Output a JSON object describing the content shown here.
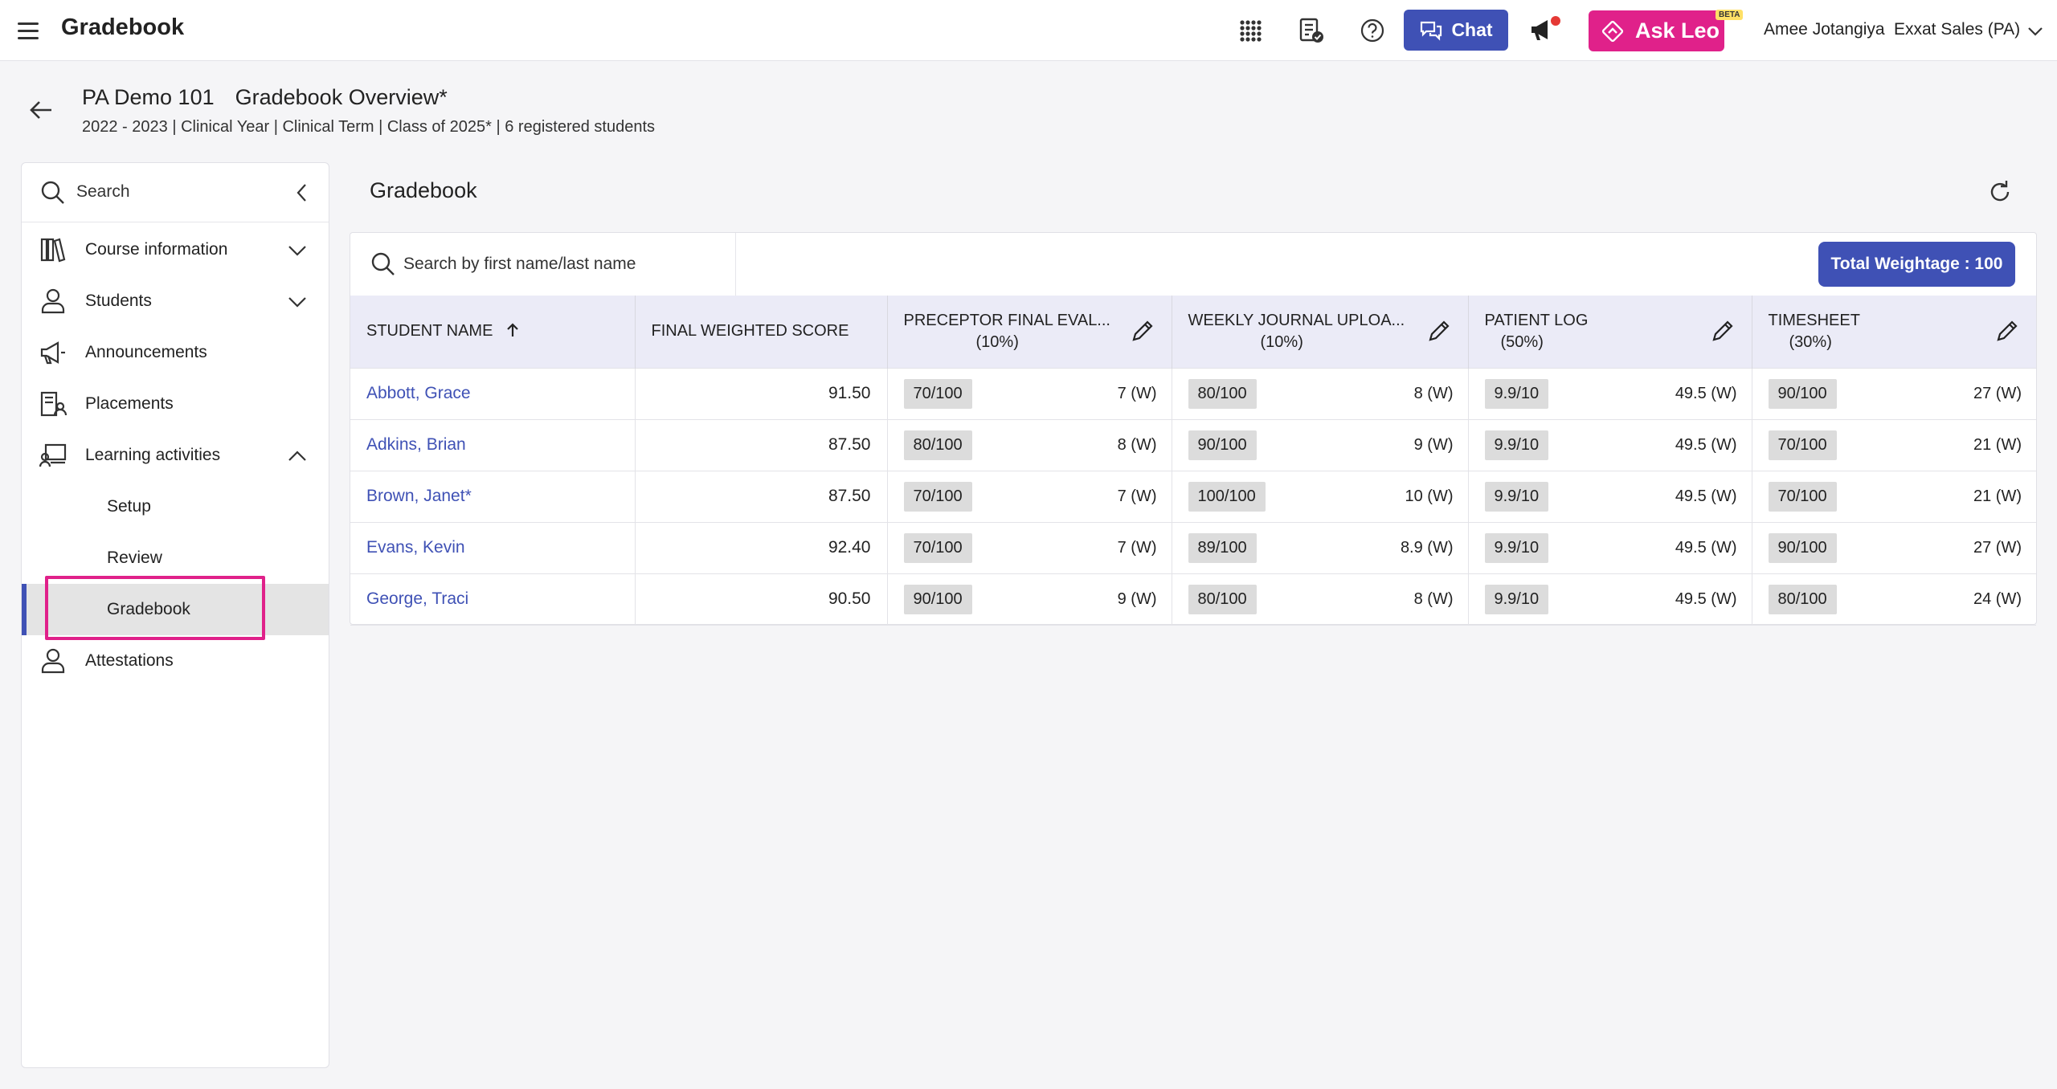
{
  "app": {
    "title": "Gradebook"
  },
  "topbar": {
    "chat_label": "Chat",
    "ask_leo_label": "Ask Leo",
    "beta_label": "BETA",
    "user_name": "Amee Jotangiya",
    "org_name": "Exxat Sales (PA)",
    "icons": [
      "menu-icon",
      "apps-grid-icon",
      "checklist-icon",
      "help-icon",
      "chat-bubble-icon",
      "megaphone-icon",
      "leo-logo-icon",
      "chevron-down-icon"
    ]
  },
  "page": {
    "course_code": "PA Demo 101",
    "course_page": "Gradebook Overview*",
    "subtitle": "2022 - 2023 | Clinical Year | Clinical Term | Class of 2025* | 6 registered students"
  },
  "sidebar": {
    "search_label": "Search",
    "items": [
      {
        "label": "Course information",
        "icon": "books-icon",
        "expanded": false
      },
      {
        "label": "Students",
        "icon": "person-icon",
        "expanded": false
      },
      {
        "label": "Announcements",
        "icon": "megaphone-icon"
      },
      {
        "label": "Placements",
        "icon": "placement-icon"
      },
      {
        "label": "Learning activities",
        "icon": "learning-icon",
        "expanded": true
      },
      {
        "label": "Attestations",
        "icon": "person-icon"
      }
    ],
    "subitems": [
      {
        "label": "Setup"
      },
      {
        "label": "Review"
      },
      {
        "label": "Gradebook",
        "active": true
      }
    ]
  },
  "main": {
    "title": "Gradebook",
    "search_placeholder": "Search by first name/last name",
    "total_weightage_label": "Total Weightage : 100",
    "columns": [
      {
        "label": "STUDENT NAME"
      },
      {
        "label": "FINAL WEIGHTED SCORE"
      },
      {
        "label": "PRECEPTOR FINAL EVAL...",
        "weight": "(10%)"
      },
      {
        "label": "WEEKLY JOURNAL UPLOA...",
        "weight": "(10%)"
      },
      {
        "label": "PATIENT LOG",
        "weight": "(50%)"
      },
      {
        "label": "TIMESHEET",
        "weight": "(30%)"
      }
    ],
    "rows": [
      {
        "name": "Abbott, Grace",
        "final": "91.50",
        "cells": [
          {
            "score": "70/100",
            "w": "7 (W)"
          },
          {
            "score": "80/100",
            "w": "8 (W)"
          },
          {
            "score": "9.9/10",
            "w": "49.5 (W)"
          },
          {
            "score": "90/100",
            "w": "27 (W)"
          }
        ]
      },
      {
        "name": "Adkins, Brian",
        "final": "87.50",
        "cells": [
          {
            "score": "80/100",
            "w": "8 (W)"
          },
          {
            "score": "90/100",
            "w": "9 (W)"
          },
          {
            "score": "9.9/10",
            "w": "49.5 (W)"
          },
          {
            "score": "70/100",
            "w": "21 (W)"
          }
        ]
      },
      {
        "name": "Brown, Janet*",
        "final": "87.50",
        "cells": [
          {
            "score": "70/100",
            "w": "7 (W)"
          },
          {
            "score": "100/100",
            "w": "10 (W)"
          },
          {
            "score": "9.9/10",
            "w": "49.5 (W)"
          },
          {
            "score": "70/100",
            "w": "21 (W)"
          }
        ]
      },
      {
        "name": "Evans, Kevin",
        "final": "92.40",
        "cells": [
          {
            "score": "70/100",
            "w": "7 (W)"
          },
          {
            "score": "89/100",
            "w": "8.9 (W)"
          },
          {
            "score": "9.9/10",
            "w": "49.5 (W)"
          },
          {
            "score": "90/100",
            "w": "27 (W)"
          }
        ]
      },
      {
        "name": "George, Traci",
        "final": "90.50",
        "cells": [
          {
            "score": "90/100",
            "w": "9 (W)"
          },
          {
            "score": "80/100",
            "w": "8 (W)"
          },
          {
            "score": "9.9/10",
            "w": "49.5 (W)"
          },
          {
            "score": "80/100",
            "w": "24 (W)"
          }
        ]
      }
    ]
  },
  "colors": {
    "primary": "#3f51b5",
    "accent": "#e0218a",
    "header_bg": "#ebebf7",
    "chip_bg": "#dcdcdc"
  }
}
